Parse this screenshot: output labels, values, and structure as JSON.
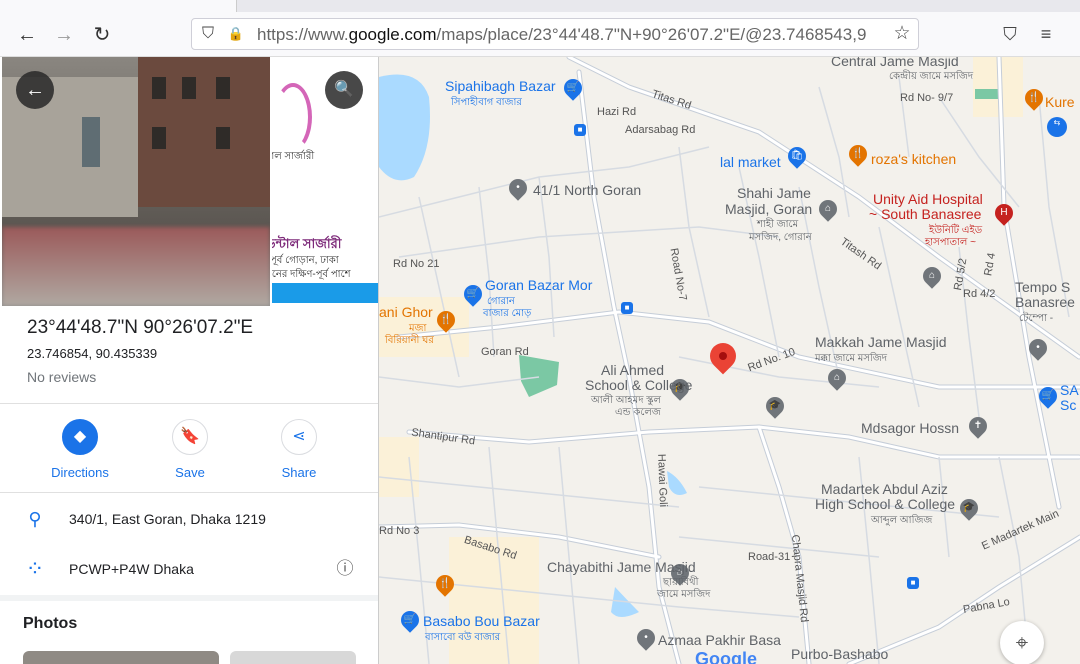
{
  "browser": {
    "url_prefix": "https://www.",
    "url_domain": "google.com",
    "url_rest": "/maps/place/23°44'48.7\"N+90°26'07.2\"E/@23.7468543,9",
    "back_icon": "←",
    "forward_icon": "→",
    "reload_icon": "↻",
    "shield_icon": "⛉",
    "lock_icon": "🔒",
    "star_icon": "☆",
    "pocket_icon": "⛉",
    "menu_icon": "≡"
  },
  "panel": {
    "back_icon": "←",
    "search_icon": "🔍",
    "photo2_text": [
      "ডন্টাল সার্জারী",
      "পূর্ব গোড়ান, ঢাকা",
      "য়নের দক্ষিণ-পূর্ব পাশে",
      "াল সার্জারী"
    ],
    "title": "23°44'48.7\"N 90°26'07.2\"E",
    "decimal": "23.746854, 90.435339",
    "reviews": "No reviews",
    "actions": [
      {
        "label": "Directions",
        "icon": "◆"
      },
      {
        "label": "Save",
        "icon": "🔖"
      },
      {
        "label": "Share",
        "icon": "⋖"
      }
    ],
    "address": "340/1, East Goran, Dhaka 1219",
    "plus_code": "PCWP+P4W Dhaka",
    "pin_icon": "⚲",
    "pluscode_icon": "⁘",
    "info_icon": "ⓘ",
    "photos_heading": "Photos"
  },
  "map": {
    "labels": {
      "sipahibagh": "Sipahibagh Bazar",
      "sipahibagh_bn": "সিপাহীবাগ বাজার",
      "central": "Central Jame Masjid",
      "central_bn": "কেন্দ্রীয় জামে মসজিদ",
      "rd9_7": "Rd No- 9/7",
      "kure": "Kure",
      "hazi": "Hazi Rd",
      "adarsabag": "Adarsabag Rd",
      "titas": "Titas Rd",
      "lal": "lal market",
      "roza": "roza's kitchen",
      "shahi": "Shahi Jame",
      "shahi2": "Masjid, Goran",
      "shahi_bn": "শাহী জামে",
      "shahi_bn2": "মসজিদ, গোরান",
      "unity": "Unity Aid Hospital",
      "unity2": "~ South Banasree",
      "unity_bn": "ইউনিটি এইড",
      "unity_bn2": "হাসপাতাল ~",
      "north_goran": "41/1 North Goran",
      "titash": "Titash Rd",
      "rd21": "Rd No 21",
      "goran_bazar": "Goran Bazar Mor",
      "goran_bazar_bn": "গোরান",
      "goran_bazar_bn2": "বাজার মোড়",
      "rd7": "Road No-7",
      "rd52": "Rd 5/2",
      "rd4": "Rd 4",
      "rd42": "Rd 4/2",
      "tempo": "Tempo S",
      "banasree": "Banasree",
      "banasree_bn": "টেম্পো -",
      "hani": "ani Ghor",
      "hani_bn": "মজা",
      "hani_bn2": "বিরিয়ানী ঘর",
      "goran_rd": "Goran Rd",
      "rd10": "Rd No. 10",
      "makkah": "Makkah Jame Masjid",
      "makkah_bn": "মক্কা জামে মসজিদ",
      "ali": "Ali Ahmed",
      "ali2": "School & College",
      "ali_bn": "আলী আহমদ স্কুল",
      "ali_bn2": "এন্ড কলেজ",
      "shantipur": "Shantipur Rd",
      "mdsagor": "Mdsagor Hossn",
      "hawai": "Hawai Goli",
      "madartek": "Madartek Abdul Aziz",
      "madartek2": "High School & College",
      "madartek_bn": "আব্দুল আজিজ",
      "rd3": "Rd No 3",
      "basabo": "Basabo Rd",
      "chapra": "Chapra Masjid Rd",
      "madartek_main": "E Madartek Main",
      "chayabithi": "Chayabithi Jame Masjid",
      "chayabithi_bn": "ছায়াবিথী",
      "chayabithi_bn2": "জামে মসজিদ",
      "road31": "Road-31",
      "basabo_bou": "Basabo Bou Bazar",
      "basabo_bou_bn": "বাসাবো বউ বাজার",
      "azmaa": "Azmaa Pakhir Basa",
      "purbo": "Purbo-Bashabo",
      "pabna": "Pabna Lo",
      "sa": "SA",
      "sc": "Sc",
      "google": "Google"
    },
    "locate_icon": "⌖"
  },
  "colors": {
    "accent": "#1a73e8",
    "pin": "#ea4335",
    "water": "#aadaff",
    "park": "#7bc8a4"
  }
}
